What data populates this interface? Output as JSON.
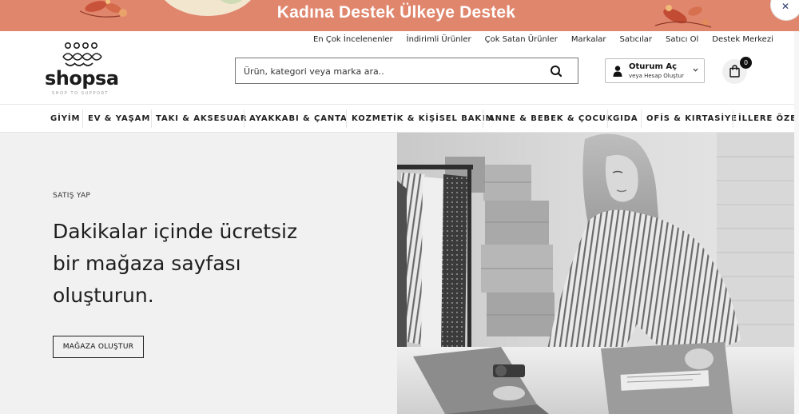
{
  "promo": {
    "text": "Kadına Destek Ülkeye Destek",
    "close_icon": "close-icon",
    "colors": {
      "background": "#e0866d",
      "text": "#ffffff"
    }
  },
  "top_links": [
    "En Çok İncelenenler",
    "İndirimli Ürünler",
    "Çok Satan Ürünler",
    "Markalar",
    "Satıcılar",
    "Satıcı Ol",
    "Destek Merkezi"
  ],
  "logo": {
    "wordmark": "shopsa",
    "tagline": "SHOP TO SUPPORT"
  },
  "search": {
    "placeholder": "Ürün, kategori veya marka ara..",
    "icon": "search-icon"
  },
  "account": {
    "title": "Oturum Aç",
    "subtitle": "veya Hesap Oluştur",
    "icon": "user-icon"
  },
  "cart": {
    "count": "0",
    "icon": "shopping-bag-icon"
  },
  "categories": [
    "GİYİM",
    "EV & YAŞAM",
    "TAKI & AKSESUAR",
    "AYAKKABI & ÇANTA",
    "KOZMETİK & KİŞİSEL BAKIM",
    "ANNE & BEBEK & ÇOCUK",
    "GIDA",
    "OFİS & KIRTASİYE",
    "İLLERE ÖZEL"
  ],
  "hero": {
    "eyebrow": "SATIŞ YAP",
    "title_lines": [
      "Dakikalar içinde ücretsiz",
      "bir mağaza sayfası",
      "oluşturun."
    ],
    "button_label": "MAĞAZA OLUŞTUR",
    "image": "woman-packing-orders-photo"
  }
}
